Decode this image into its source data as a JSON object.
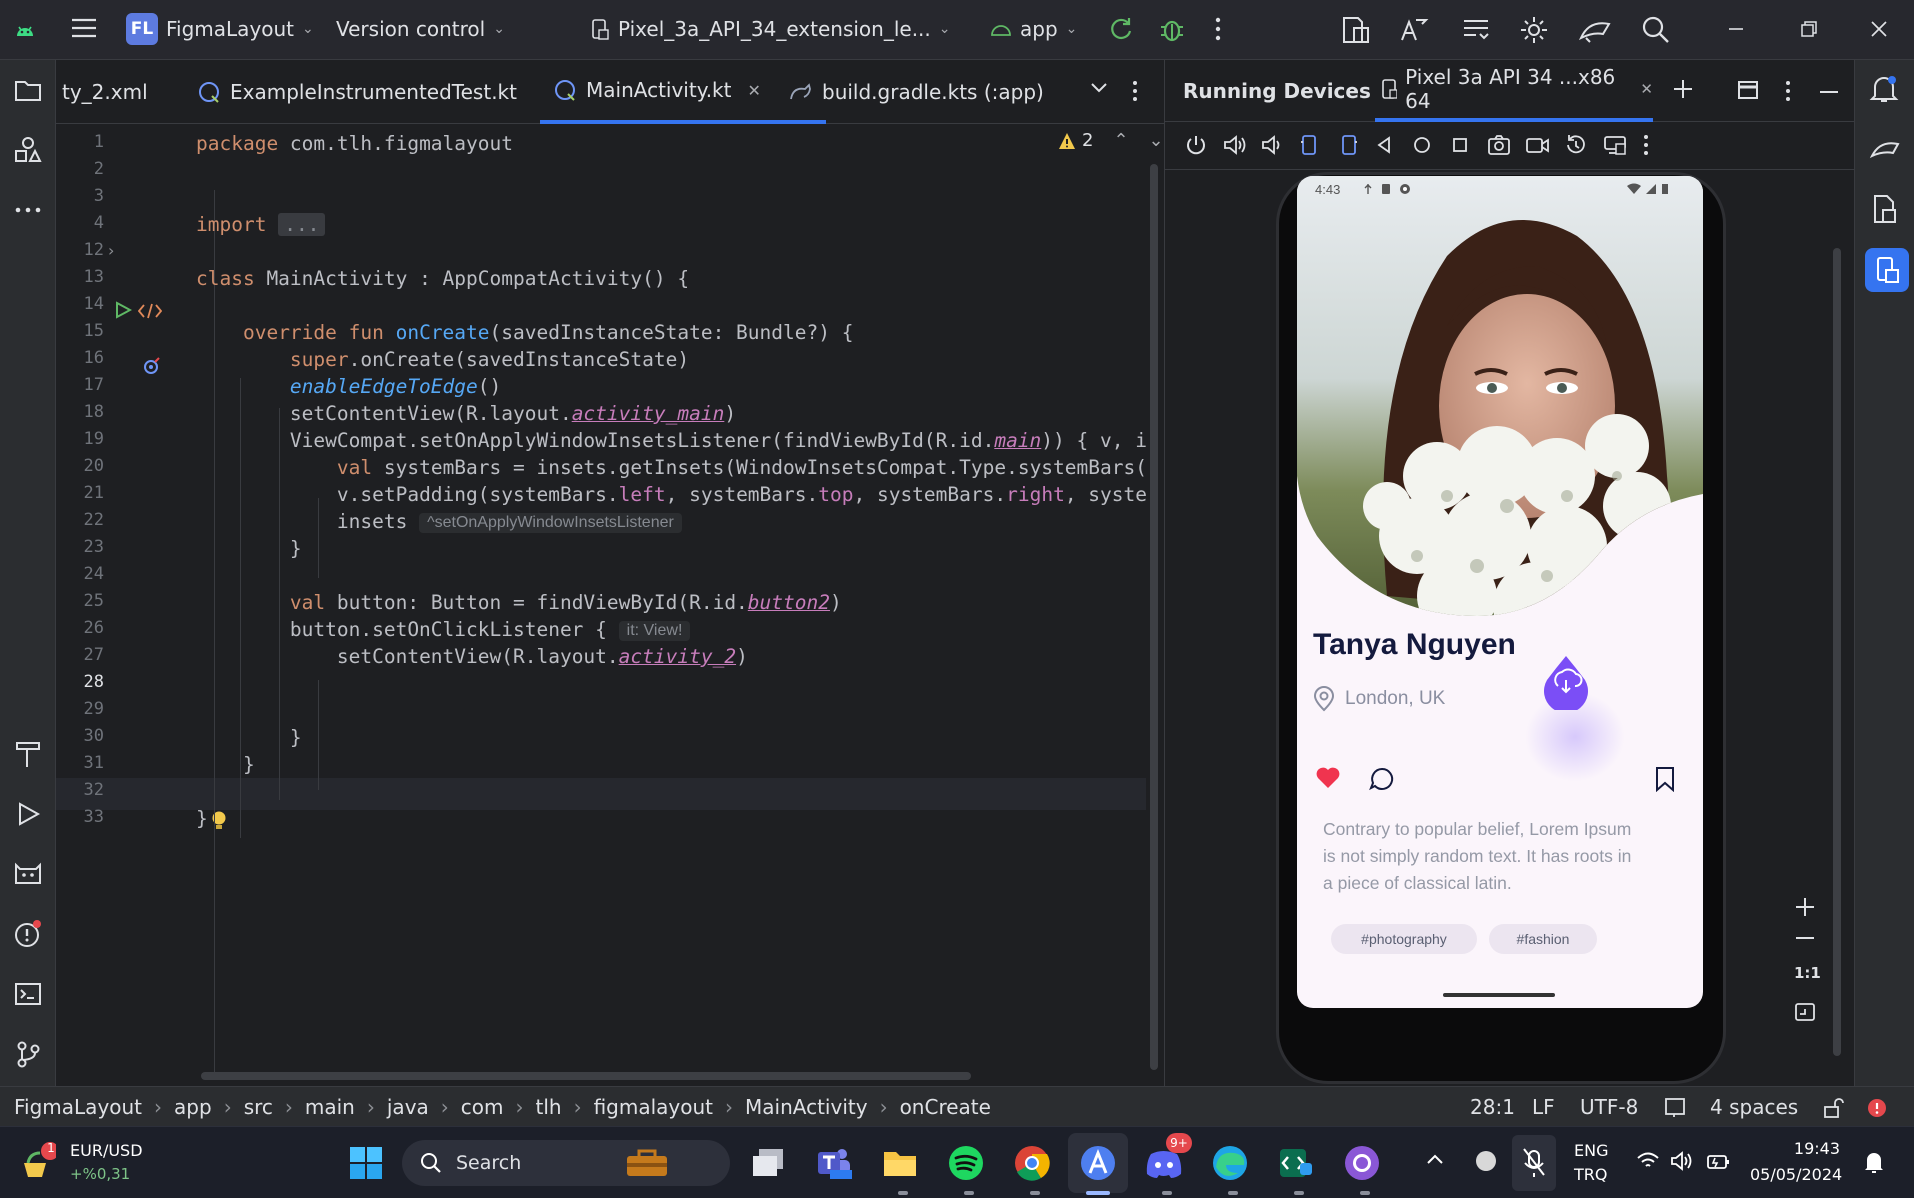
{
  "titlebar": {
    "project_initials": "FL",
    "project_name": "FigmaLayout",
    "version_control": "Version control",
    "device_selector": "Pixel_3a_API_34_extension_le...",
    "run_config": "app"
  },
  "editor": {
    "tabs": [
      {
        "label": "ty_2.xml"
      },
      {
        "label": "ExampleInstrumentedTest.kt"
      },
      {
        "label": "MainActivity.kt"
      },
      {
        "label": "build.gradle.kts (:app)"
      }
    ],
    "warning_count": "2",
    "line_numbers": [
      "1",
      "2",
      "3",
      "4",
      "12",
      "13",
      "14",
      "15",
      "16",
      "17",
      "18",
      "19",
      "20",
      "21",
      "22",
      "23",
      "24",
      "25",
      "26",
      "27",
      "28",
      "29",
      "30",
      "31",
      "32",
      "33"
    ],
    "code": {
      "l1_kw": "package",
      "l1_rest": " com.tlh.figmalayout",
      "l4_kw": "import",
      "l4_fold": "...",
      "l13_kw": "class",
      "l13_rest": " MainActivity : AppCompatActivity() {",
      "l15_kw1": "override",
      "l15_kw2": " fun ",
      "l15_fn": "onCreate",
      "l15_rest": "(savedInstanceState: Bundle?) {",
      "l16_kw": "super",
      "l16_rest": ".onCreate(savedInstanceState)",
      "l17_fn": "enableEdgeToEdge",
      "l17_rest": "()",
      "l18_a": "setContentView(R.layout.",
      "l18_b": "activity_main",
      "l18_c": ")",
      "l19_a": "ViewCompat.setOnApplyWindowInsetsListener(findViewById(R.id.",
      "l19_b": "main",
      "l19_c": ")) { v, i",
      "l20_kw": "val",
      "l20_rest": " systemBars = insets.getInsets(WindowInsetsCompat.Type.systemBars())",
      "l21_a": "v.setPadding(systemBars.",
      "l21_p1": "left",
      "l21_b": ", systemBars.",
      "l21_p2": "top",
      "l21_c": ", systemBars.",
      "l21_p3": "right",
      "l21_d": ", systemBars.bottom)",
      "l22_a": "insets",
      "l22_hint": "^setOnApplyWindowInsetsListener",
      "l23": "}",
      "l25_kw": "val",
      "l25_a": " button: Button = findViewById(R.id.",
      "l25_b": "button2",
      "l25_c": ")",
      "l26_a": "button.setOnClickListener {",
      "l26_hint": "it: View!",
      "l27_a": "setContentView(R.layout.",
      "l27_b": "activity_2",
      "l27_c": ")",
      "l30": "}",
      "l31": "}",
      "l33": "}"
    }
  },
  "device_panel": {
    "title": "Running Devices",
    "device_tab": "Pixel 3a API 34 ...x86 64"
  },
  "phone": {
    "time": "4:43",
    "name": "Tanya Nguyen",
    "location": "London, UK",
    "description_line1": "Contrary to popular belief, Lorem Ipsum",
    "description_line2": "is not simply random text. It has roots in",
    "description_line3": "a piece of classical latin.",
    "tags": [
      "#photography",
      "#fashion"
    ],
    "accent": "#7b4ef6",
    "heart_color": "#f0344f"
  },
  "zoom_controls": {
    "actual_size": "1:1"
  },
  "statusbar": {
    "breadcrumbs": [
      "FigmaLayout",
      "app",
      "src",
      "main",
      "java",
      "com",
      "tlh",
      "figmalayout",
      "MainActivity",
      "onCreate"
    ],
    "position": "28:1",
    "line_sep": "LF",
    "encoding": "UTF-8",
    "indent": "4 spaces"
  },
  "taskbar": {
    "ticker_symbol": "EUR/USD",
    "ticker_change": "+%0,31",
    "ticker_badge": "1",
    "search": "Search",
    "discord_badge": "9+",
    "lang_top": "ENG",
    "lang_bottom": "TRQ",
    "time": "19:43",
    "date": "05/05/2024"
  }
}
